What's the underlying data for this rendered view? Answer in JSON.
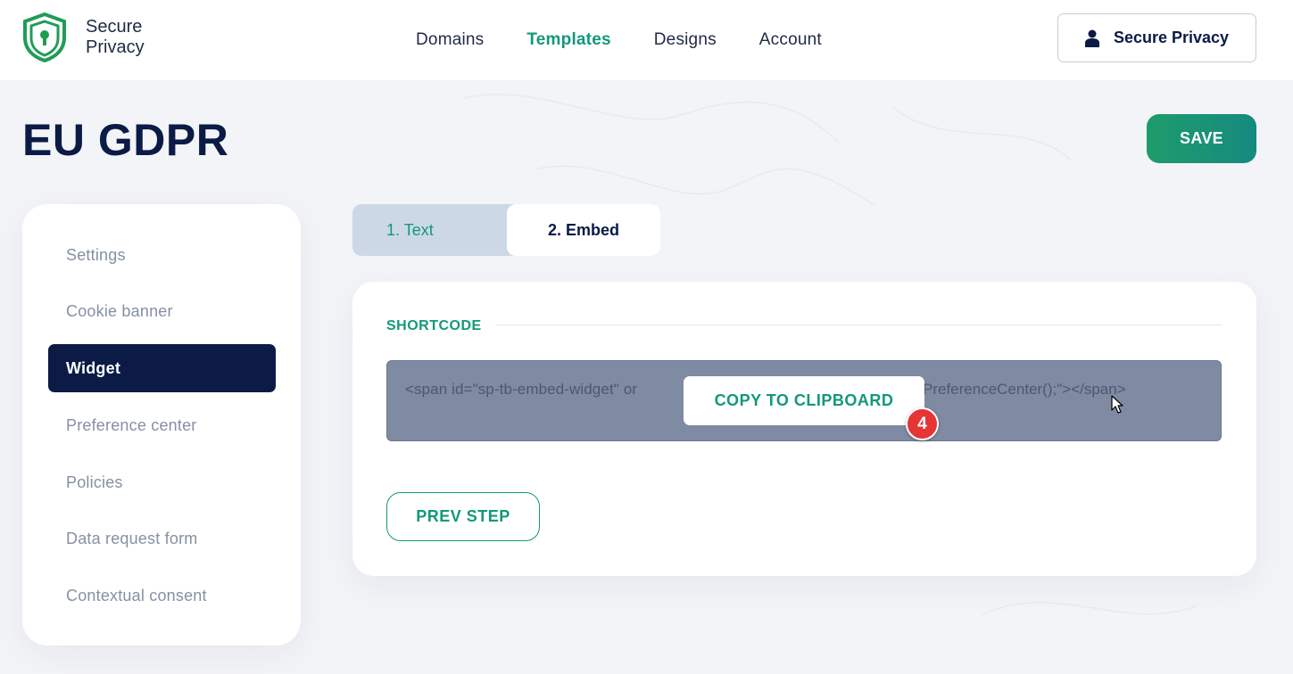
{
  "brand": {
    "name_line1": "Secure",
    "name_line2": "Privacy",
    "logo_icon": "shield-lock-icon",
    "accent": "#13987a",
    "navy": "#0b1b46"
  },
  "nav": {
    "items": [
      {
        "label": "Domains",
        "active": false
      },
      {
        "label": "Templates",
        "active": true
      },
      {
        "label": "Designs",
        "active": false
      },
      {
        "label": "Account",
        "active": false
      }
    ]
  },
  "account": {
    "label": "Secure Privacy",
    "icon": "user-icon"
  },
  "page": {
    "title": "EU GDPR",
    "save_label": "SAVE"
  },
  "sidebar": {
    "items": [
      {
        "label": "Settings",
        "active": false
      },
      {
        "label": "Cookie banner",
        "active": false
      },
      {
        "label": "Widget",
        "active": true
      },
      {
        "label": "Preference center",
        "active": false
      },
      {
        "label": "Policies",
        "active": false
      },
      {
        "label": "Data request form",
        "active": false
      },
      {
        "label": "Contextual consent",
        "active": false
      }
    ]
  },
  "tabs": {
    "items": [
      {
        "label": "1. Text",
        "active": false
      },
      {
        "label": "2. Embed",
        "active": true
      }
    ]
  },
  "embed": {
    "section_label": "SHORTCODE",
    "code_visible_start": "<span id=\"sp-tb-embed-widget\" or",
    "code_visible_end": "PreferenceCenter();\"></span>",
    "copy_label": "COPY TO CLIPBOARD",
    "step_badge": "4",
    "prev_label": "PREV STEP"
  }
}
